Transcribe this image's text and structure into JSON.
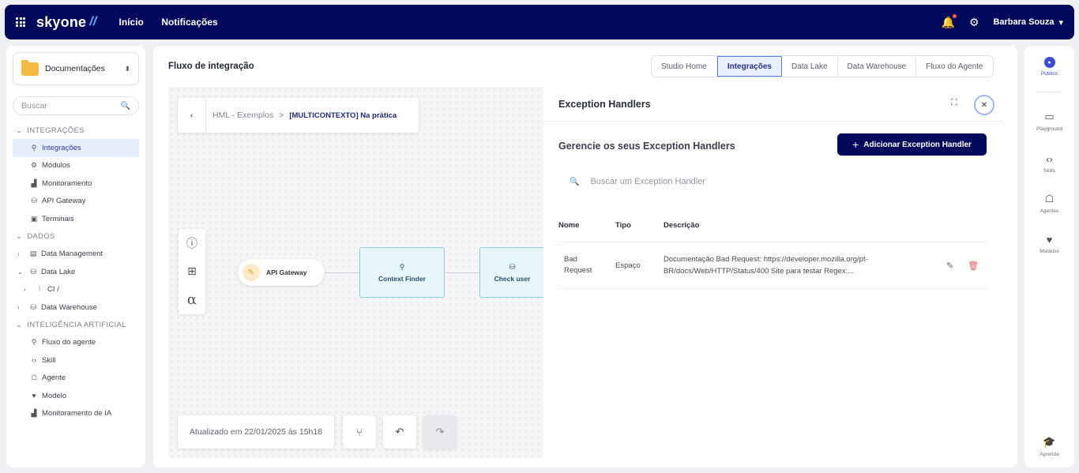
{
  "topbar": {
    "brand": "skyone",
    "nav": [
      "Início",
      "Notificações"
    ],
    "user": "Barbara Souza",
    "colors": {
      "bg": "#030a5c",
      "accent": "#4db8ff"
    }
  },
  "sidebar": {
    "workspace": "Documentações",
    "search_placeholder": "Buscar",
    "sections": [
      {
        "label": "INTEGRAÇÕES",
        "items": [
          "Integrações",
          "Módulos",
          "Monitoramento",
          "API Gateway",
          "Terminais"
        ]
      },
      {
        "label": "DADOS",
        "items": [
          "Data Management",
          "Data Lake",
          "CI /",
          "Data Warehouse"
        ]
      },
      {
        "label": "INTELIGÊNCIA ARTIFICIAL",
        "items": [
          "Fluxo do agente",
          "Skill",
          "Agente",
          "Modelo",
          "Monitoramento de IA"
        ]
      }
    ]
  },
  "main": {
    "title": "Fluxo de integração",
    "tabs": [
      "Studio Home",
      "Integrações",
      "Data Lake",
      "Data Warehouse",
      "Fluxo do Agente"
    ],
    "active_tab": "Integrações",
    "breadcrumb": {
      "parent": "HML - Exemplos",
      "separator": ">",
      "current": "[MULTICONTEXTO] Na prática"
    },
    "nodes": [
      "API Gateway",
      "Context Finder",
      "Check user"
    ],
    "status": "Atualizado em 22/01/2025 às 15h18"
  },
  "exception_panel": {
    "title": "Exception Handlers",
    "subtitle": "Gerencie os seus Exception Handlers",
    "add_button": "Adicionar Exception Handler",
    "search_placeholder": "Buscar um Exception Handler",
    "columns": [
      "Nome",
      "Tipo",
      "Descrição"
    ],
    "rows": [
      {
        "name_line1": "Bad",
        "name_line2": "Request",
        "type": "Espaço",
        "desc_line1": "Documentação Bad Request: https://developer.mozilla.org/pt-",
        "desc_line2": "BR/docs/Web/HTTP/Status/400 Site para testar Regex:..."
      }
    ]
  },
  "rail": {
    "items": [
      "Público",
      "Playground",
      "Skills",
      "Agentes",
      "Modelos",
      "Aprenda"
    ],
    "active": "Público"
  }
}
